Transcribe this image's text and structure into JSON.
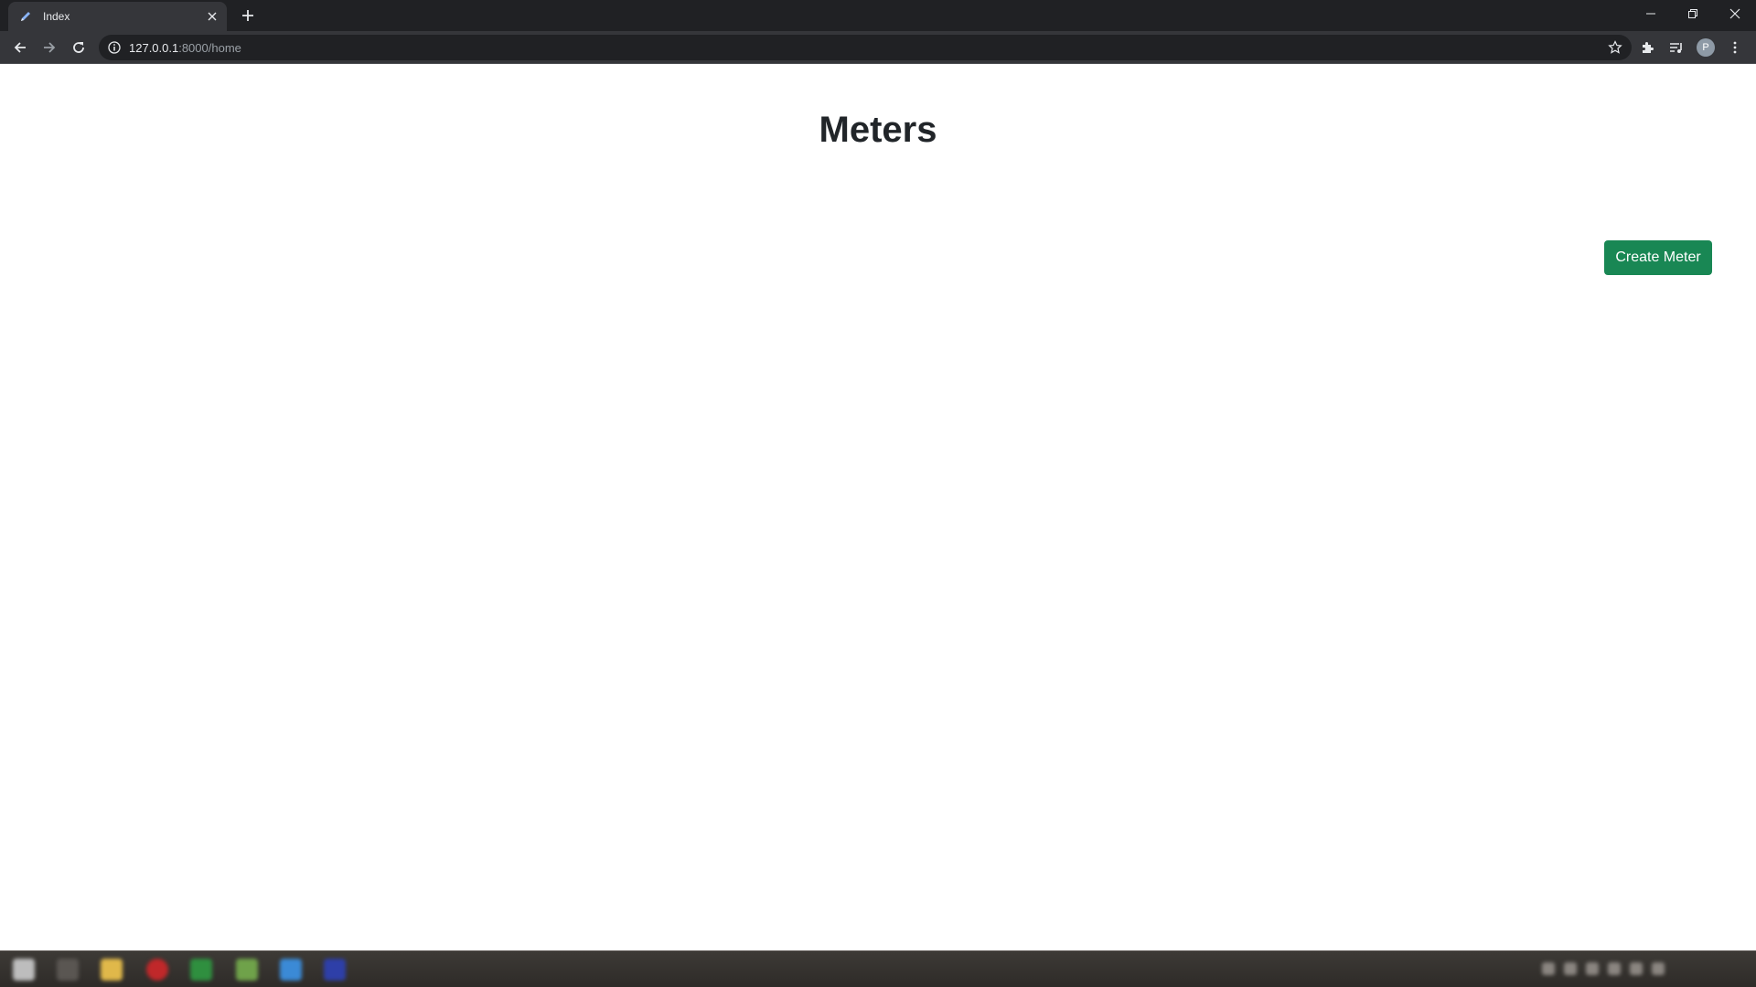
{
  "browser": {
    "tab": {
      "title": "Index",
      "favicon": "pencil-icon"
    },
    "new_tab_icon": "plus-icon",
    "url": {
      "host": "127.0.0.1",
      "path": ":8000/home"
    },
    "profile_initial": "P",
    "icons": {
      "back": "arrow-left-icon",
      "forward": "arrow-right-icon",
      "reload": "reload-icon",
      "info": "info-icon",
      "bookmark": "star-icon",
      "extensions": "puzzle-icon",
      "media": "media-queue-icon",
      "menu": "kebab-menu-icon"
    }
  },
  "page": {
    "title": "Meters",
    "create_button_label": "Create Meter"
  },
  "colors": {
    "primary_button": "#198754",
    "title_text": "#212529",
    "chrome_dark": "#202124",
    "chrome_toolbar": "#35363a"
  }
}
